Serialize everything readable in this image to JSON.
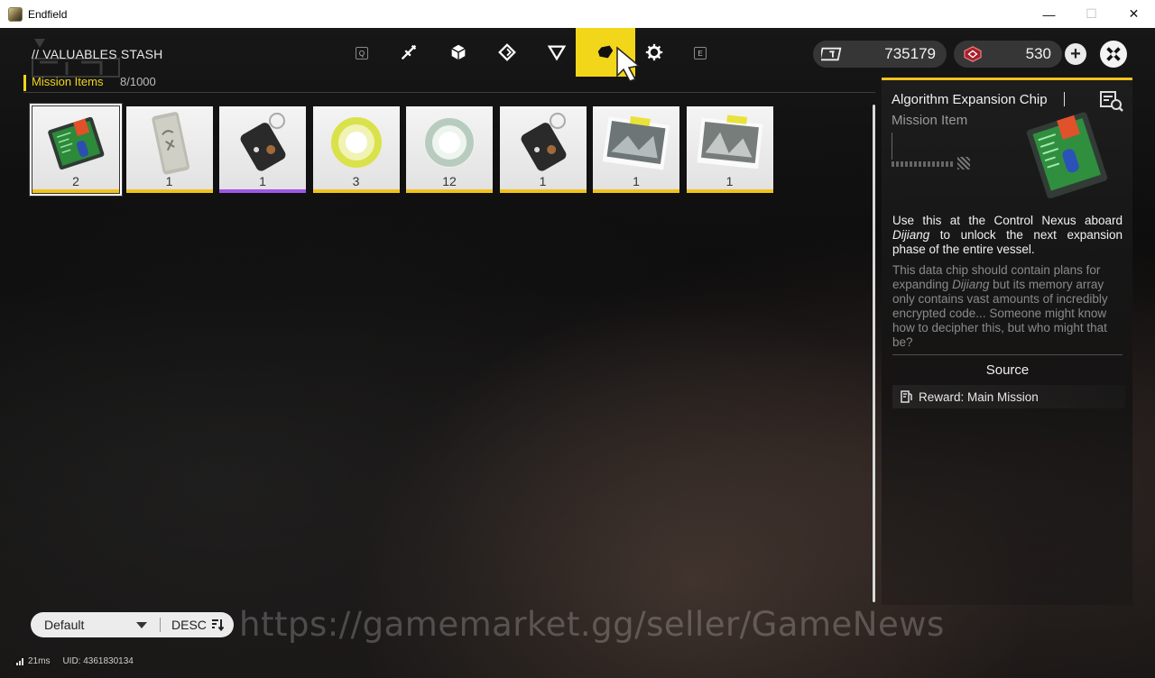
{
  "window": {
    "title": "Endfield",
    "controls": [
      "minimize",
      "restore",
      "close"
    ]
  },
  "header": {
    "stash_title": "// VALUABLES STASH",
    "tab_key_left": "Q",
    "tab_key_right": "E",
    "tabs": [
      {
        "icon": "weapon-icon",
        "active": false
      },
      {
        "icon": "cube-icon",
        "active": false
      },
      {
        "icon": "diamond-icon",
        "active": false
      },
      {
        "icon": "triangle-icon",
        "active": false
      },
      {
        "icon": "mission-chip-icon",
        "active": true
      },
      {
        "icon": "gear-icon",
        "active": false
      }
    ],
    "currency": [
      {
        "icon": "ticket-icon",
        "value": "735179"
      },
      {
        "icon": "originium-icon",
        "value": "530"
      }
    ],
    "accent_color": "#f2d61a"
  },
  "category": {
    "label": "Mission Items",
    "count": "8/1000"
  },
  "items": [
    {
      "name": "Algorithm Expansion Chip",
      "qty": "2",
      "rarity_color": "#f2c21c",
      "selected": true,
      "icon": "circuit-chip-icon"
    },
    {
      "name": "engraved-plaque",
      "qty": "1",
      "rarity_color": "#f2c21c",
      "selected": false,
      "icon": "plaque-icon"
    },
    {
      "name": "keychain-tag",
      "qty": "1",
      "rarity_color": "#9b58e8",
      "selected": false,
      "icon": "keychain-icon"
    },
    {
      "name": "glowing-ring-yellow",
      "qty": "3",
      "rarity_color": "#f2c21c",
      "selected": false,
      "icon": "ring-icon"
    },
    {
      "name": "glowing-ring-clear",
      "qty": "12",
      "rarity_color": "#f2c21c",
      "selected": false,
      "icon": "ring-icon"
    },
    {
      "name": "keychain-tag-2",
      "qty": "1",
      "rarity_color": "#f2c21c",
      "selected": false,
      "icon": "keychain-icon"
    },
    {
      "name": "photo-1",
      "qty": "1",
      "rarity_color": "#f2c21c",
      "selected": false,
      "icon": "photo-icon"
    },
    {
      "name": "photo-2",
      "qty": "1",
      "rarity_color": "#f2c21c",
      "selected": false,
      "icon": "photo-icon"
    }
  ],
  "details": {
    "name": "Algorithm Expansion Chip",
    "type": "Mission Item",
    "desc_pre": "Use this at the Control Nexus aboard ",
    "desc_em": "Dijiang",
    "desc_post": " to unlock the next expansion phase of the entire vessel.",
    "flavor_pre": "This data chip should contain plans for expanding ",
    "flavor_em": "Dijiang",
    "flavor_post": " but its memory array only contains vast amounts of incredibly encrypted code... Someone might know how to decipher this, but who might that be?",
    "source_title": "Source",
    "source_item": "Reward: Main Mission"
  },
  "sort": {
    "mode": "Default",
    "order": "DESC"
  },
  "watermark": "https://gamemarket.gg/seller/GameNews",
  "status": {
    "ping": "21ms",
    "uid": "UID: 4361830134"
  }
}
